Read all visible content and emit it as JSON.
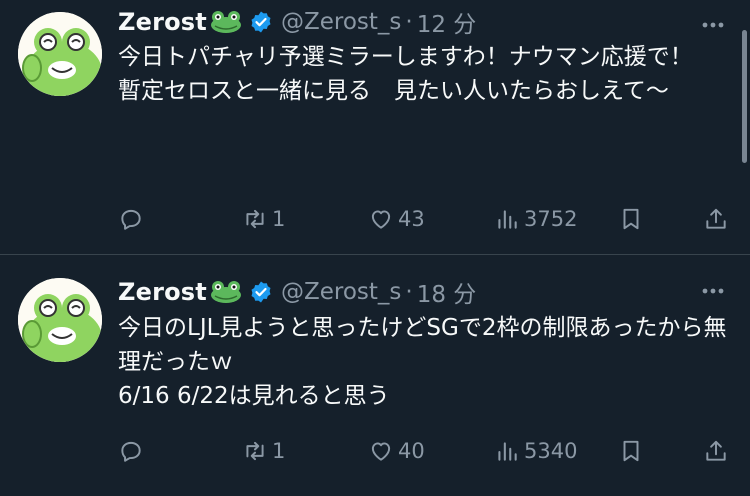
{
  "colors": {
    "background": "#15202b",
    "text_primary": "#f7f9f9",
    "text_secondary": "#8b98a5",
    "verified": "#1d9bf0",
    "divider": "#38444d"
  },
  "tweets": [
    {
      "display_name": "Zerost",
      "name_emoji": "frog-emoji",
      "verified_icon": "verified-badge-icon",
      "handle": "@Zerost_s",
      "dot": "·",
      "time": "12 分",
      "lines": [
        "今日トパチャリ予選ミラーしますわ！ナウマン応援で！",
        "暫定セロスと一緒に見る　見たい人いたらおしえて〜"
      ],
      "actions": {
        "reply_icon": "reply-icon",
        "retweets": "1",
        "likes": "43",
        "views": "3752",
        "bookmark_icon": "bookmark-icon",
        "share_icon": "share-icon"
      }
    },
    {
      "display_name": "Zerost",
      "name_emoji": "frog-emoji",
      "verified_icon": "verified-badge-icon",
      "handle": "@Zerost_s",
      "dot": "·",
      "time": "18 分",
      "lines": [
        "今日のLJL見ようと思ったけどSGで2枠の制限あったから無理だったｗ",
        "6/16 6/22は見れると思う"
      ],
      "actions": {
        "reply_icon": "reply-icon",
        "retweets": "1",
        "likes": "40",
        "views": "5340",
        "bookmark_icon": "bookmark-icon",
        "share_icon": "share-icon"
      }
    }
  ]
}
